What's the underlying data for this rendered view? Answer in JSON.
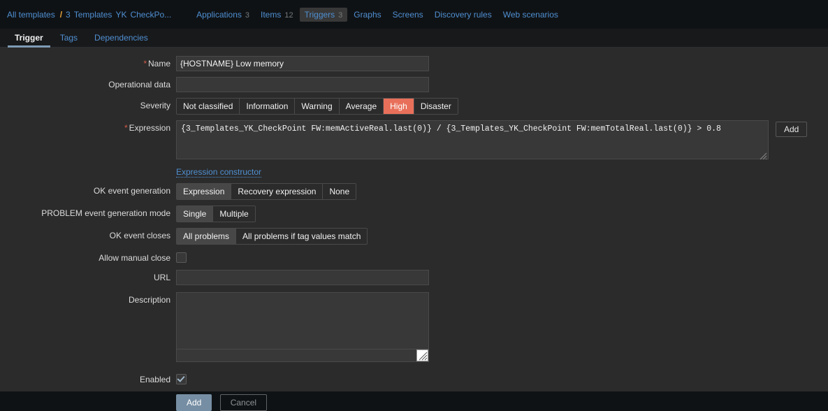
{
  "breadcrumb": {
    "all_templates": "All templates",
    "separator": "/",
    "template_id": "3",
    "template_word": "Templates",
    "template_group": "YK",
    "template_name": "CheckPo..."
  },
  "nav": {
    "items": [
      {
        "label": "Applications",
        "count": "3",
        "active": false
      },
      {
        "label": "Items",
        "count": "12",
        "active": false
      },
      {
        "label": "Triggers",
        "count": "3",
        "active": true
      },
      {
        "label": "Graphs",
        "count": "",
        "active": false
      },
      {
        "label": "Screens",
        "count": "",
        "active": false
      },
      {
        "label": "Discovery rules",
        "count": "",
        "active": false
      },
      {
        "label": "Web scenarios",
        "count": "",
        "active": false
      }
    ]
  },
  "tabs": [
    {
      "label": "Trigger",
      "active": true
    },
    {
      "label": "Tags",
      "active": false
    },
    {
      "label": "Dependencies",
      "active": false
    }
  ],
  "form": {
    "name": {
      "label": "Name",
      "required": "*",
      "value": "{HOSTNAME} Low memory",
      "placeholder": ""
    },
    "operational_data": {
      "label": "Operational data",
      "value": "",
      "placeholder": ""
    },
    "severity": {
      "label": "Severity",
      "options": [
        {
          "label": "Not classified",
          "selected": false
        },
        {
          "label": "Information",
          "selected": false
        },
        {
          "label": "Warning",
          "selected": false
        },
        {
          "label": "Average",
          "selected": false
        },
        {
          "label": "High",
          "selected": true
        },
        {
          "label": "Disaster",
          "selected": false
        }
      ],
      "selected_color": "#e8705a"
    },
    "expression": {
      "label": "Expression",
      "required": "*",
      "value": "{3_Templates_YK_CheckPoint FW:memActiveReal.last(0)} / {3_Templates_YK_CheckPoint FW:memTotalReal.last(0)} > 0.8",
      "add_button": "Add",
      "constructor_link": "Expression constructor"
    },
    "ok_event_generation": {
      "label": "OK event generation",
      "options": [
        {
          "label": "Expression",
          "selected": true
        },
        {
          "label": "Recovery expression",
          "selected": false
        },
        {
          "label": "None",
          "selected": false
        }
      ]
    },
    "problem_event_generation_mode": {
      "label": "PROBLEM event generation mode",
      "options": [
        {
          "label": "Single",
          "selected": true
        },
        {
          "label": "Multiple",
          "selected": false
        }
      ]
    },
    "ok_event_closes": {
      "label": "OK event closes",
      "options": [
        {
          "label": "All problems",
          "selected": true
        },
        {
          "label": "All problems if tag values match",
          "selected": false
        }
      ]
    },
    "allow_manual_close": {
      "label": "Allow manual close",
      "checked": false
    },
    "url": {
      "label": "URL",
      "value": "",
      "placeholder": ""
    },
    "description": {
      "label": "Description",
      "value": "",
      "placeholder": ""
    },
    "enabled": {
      "label": "Enabled",
      "checked": true
    },
    "actions": {
      "submit": "Add",
      "cancel": "Cancel"
    }
  }
}
